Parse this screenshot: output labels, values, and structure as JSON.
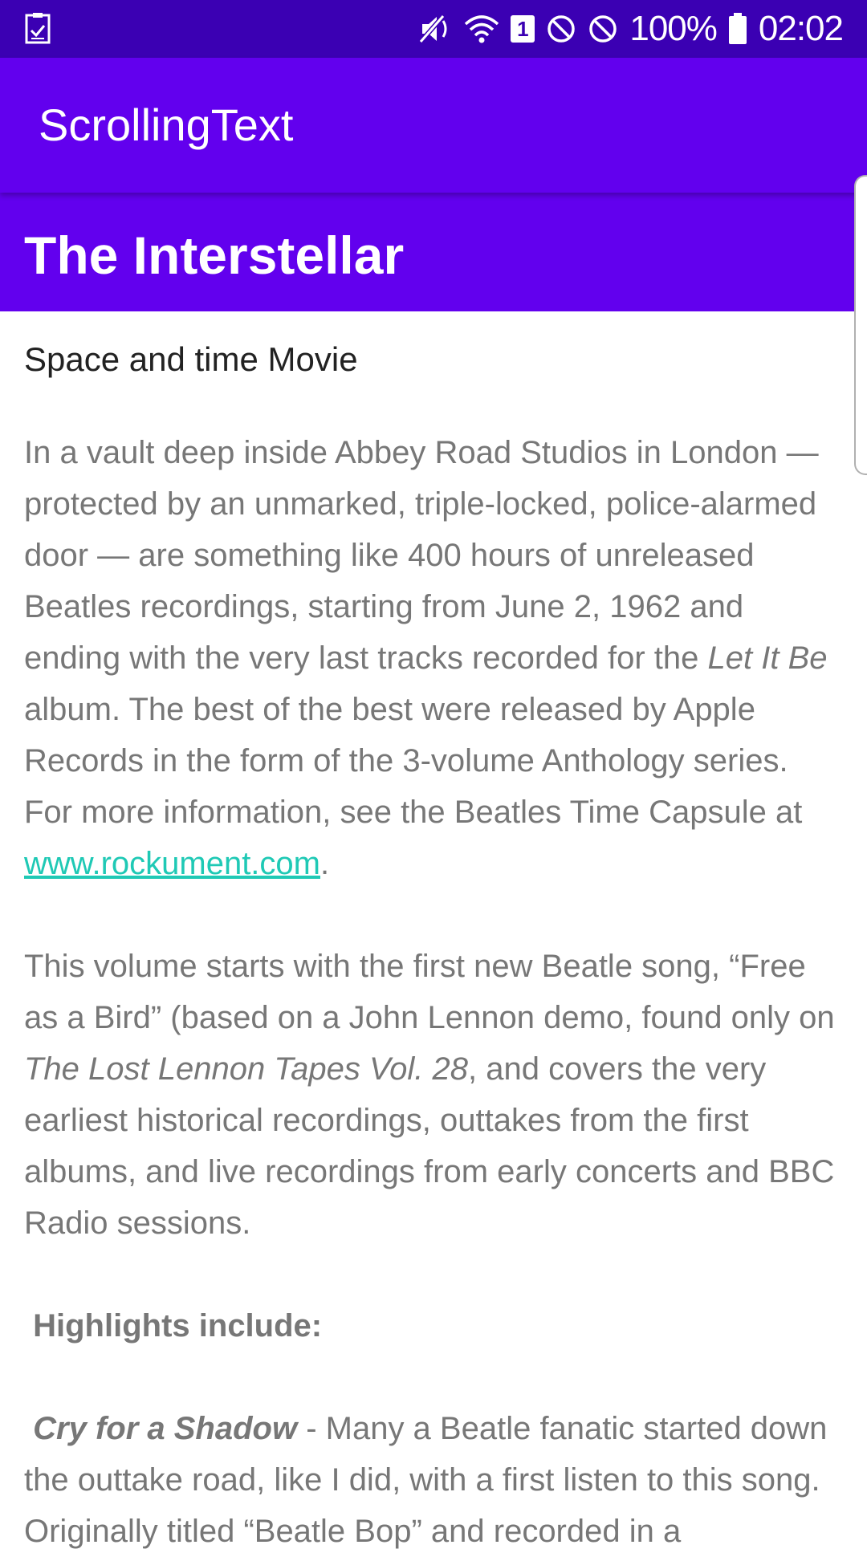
{
  "status_bar": {
    "battery_text": "100%",
    "time": "02:02",
    "sim_number": "1",
    "icons": [
      "checklist-icon",
      "mute-icon",
      "wifi-icon",
      "sim-icon",
      "block-icon",
      "block-icon",
      "battery-icon"
    ]
  },
  "app_bar": {
    "title": "ScrollingText"
  },
  "article": {
    "heading": "The Interstellar",
    "subheading": "Space and time Movie",
    "p1": {
      "a": "In a vault deep inside Abbey Road Studios in London — protected by an unmarked, triple-locked, police-alarmed door — are something like 400 hours of unreleased Beatles recordings, starting from June 2, 1962 and ending with the very last tracks recorded for the ",
      "em": "Let It Be",
      "b": " album. The best of the best were released by Apple Records in the form of the 3-volume Anthology series. For more information, see the Beatles Time Capsule at ",
      "link": "www.rockument.com",
      "c": "."
    },
    "p2": {
      "a": " This volume starts with the first new Beatle song, “Free as a Bird” (based on a John Lennon demo, found only on ",
      "em": "The Lost Lennon Tapes Vol. 28",
      "b": ", and covers the very earliest historical recordings, outtakes from the first albums, and live recordings from early concerts and BBC Radio sessions."
    },
    "highlights": "Highlights include:",
    "p3": {
      "title": "Cry for a Shadow",
      "text": " - Many a Beatle fanatic started down the outtake road, like I did, with a first listen to this song. Originally titled “Beatle Bop” and recorded in a"
    }
  },
  "colors": {
    "status_bar": "#3b00b3",
    "app_bar": "#6200ee",
    "link": "#1fc9b5",
    "body_text": "#777777"
  }
}
